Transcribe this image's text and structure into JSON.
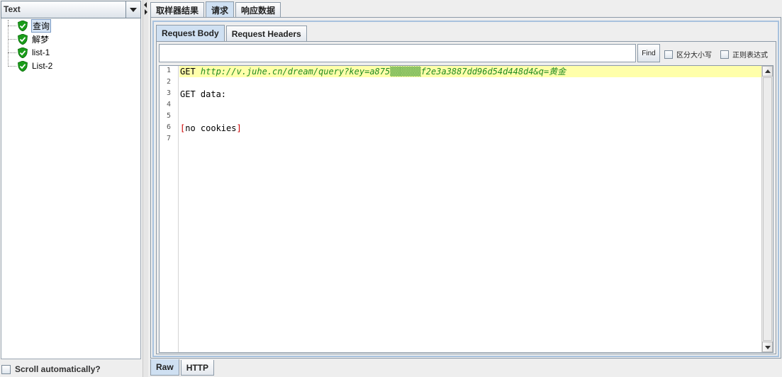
{
  "combo": {
    "value": "Text"
  },
  "tree": {
    "items": [
      {
        "label": "查询",
        "status": "success",
        "selected": true
      },
      {
        "label": "解梦",
        "status": "success",
        "selected": false
      },
      {
        "label": "list-1",
        "status": "success",
        "selected": false
      },
      {
        "label": "List-2",
        "status": "success",
        "selected": false
      }
    ]
  },
  "scroll_auto": {
    "label": "Scroll automatically?",
    "checked": false
  },
  "top_tabs": [
    {
      "label": "取样器结果",
      "active": false
    },
    {
      "label": "请求",
      "active": true
    },
    {
      "label": "响应数据",
      "active": false
    }
  ],
  "inner_tabs": [
    {
      "label": "Request Body",
      "active": true
    },
    {
      "label": "Request Headers",
      "active": false
    }
  ],
  "search": {
    "value": "",
    "find_label": "Find"
  },
  "options": {
    "case_label": "区分大小写",
    "regex_label": "正则表达式"
  },
  "editor": {
    "lines": [
      {
        "no": "1",
        "method": "GET ",
        "url": "http://v.juhe.cn/dream/query?key=a875▒▒▒▒▒▒f2e3a3887dd96d54d448d4&q=黄金"
      },
      {
        "no": "2",
        "text": ""
      },
      {
        "no": "3",
        "text": "GET data:"
      },
      {
        "no": "4",
        "text": ""
      },
      {
        "no": "5",
        "text": ""
      },
      {
        "no": "6",
        "bracket_open": "[",
        "text": "no cookies",
        "bracket_close": "]"
      },
      {
        "no": "7",
        "text": ""
      }
    ]
  },
  "bottom_tabs": [
    {
      "label": "Raw",
      "active": true
    },
    {
      "label": "HTTP",
      "active": false
    }
  ],
  "colors": {
    "accent": "#cfe0f2",
    "current_line": "#ffffaa",
    "url": "#228b22",
    "success": "#1a9c1a"
  }
}
